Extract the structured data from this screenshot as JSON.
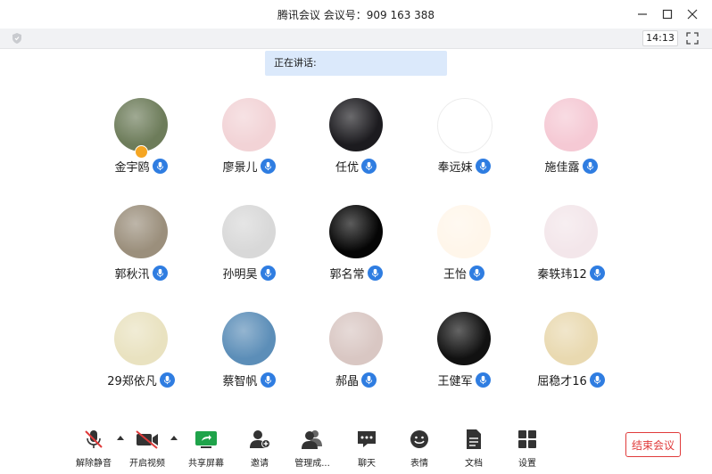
{
  "window": {
    "title": "腾讯会议 会议号：909 163 388",
    "time": "14:13"
  },
  "speaking": {
    "label": "正在讲话:"
  },
  "participants": [
    {
      "name": "金宇鸥",
      "host": true,
      "avatar_color": "#6d7c5a"
    },
    {
      "name": "廖景儿",
      "avatar_color": "#f2d3d6"
    },
    {
      "name": "任优",
      "avatar_color": "#1c1b1f"
    },
    {
      "name": "奉远妹",
      "avatar_color": "#ffffff"
    },
    {
      "name": "施佳露",
      "avatar_color": "#f5c9d4"
    },
    {
      "name": "郭秋汛",
      "avatar_color": "#9b8f7c"
    },
    {
      "name": "孙明昊",
      "avatar_color": "#d8d8d8"
    },
    {
      "name": "郭名常",
      "avatar_color": "#050505"
    },
    {
      "name": "王怡",
      "avatar_color": "#fff6ea"
    },
    {
      "name": "秦轶玮12",
      "avatar_color": "#f3e6ea"
    },
    {
      "name": "29郑依凡",
      "avatar_color": "#e9e2c0"
    },
    {
      "name": "蔡智帆",
      "avatar_color": "#5c8eb8"
    },
    {
      "name": "郝晶",
      "avatar_color": "#d9c7c3"
    },
    {
      "name": "王健军",
      "avatar_color": "#111111"
    },
    {
      "name": "屈稳才16",
      "avatar_color": "#e9d9b0"
    }
  ],
  "toolbar": {
    "unmute": "解除静音",
    "video": "开启视频",
    "share": "共享屏幕",
    "invite": "邀请",
    "members": "管理成...",
    "chat": "聊天",
    "emoji": "表情",
    "docs": "文档",
    "settings": "设置",
    "end": "结束会议"
  },
  "colors": {
    "accent": "#2f7de1",
    "danger": "#e03b3b",
    "share_green": "#1fa34a"
  }
}
